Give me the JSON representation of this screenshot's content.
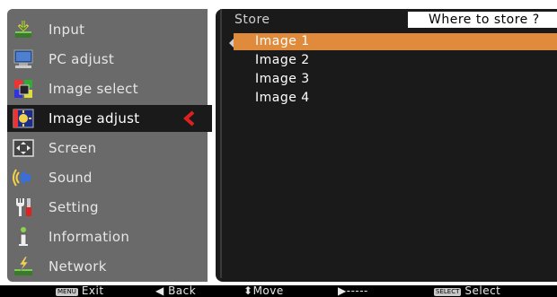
{
  "sidebar": {
    "items": [
      {
        "label": "Input",
        "icon": "input-icon"
      },
      {
        "label": "PC adjust",
        "icon": "pc-adjust-icon"
      },
      {
        "label": "Image select",
        "icon": "image-select-icon"
      },
      {
        "label": "Image adjust",
        "icon": "image-adjust-icon"
      },
      {
        "label": "Screen",
        "icon": "screen-icon"
      },
      {
        "label": "Sound",
        "icon": "sound-icon"
      },
      {
        "label": "Setting",
        "icon": "setting-icon"
      },
      {
        "label": "Information",
        "icon": "information-icon"
      },
      {
        "label": "Network",
        "icon": "network-icon"
      }
    ],
    "selected_index": 3
  },
  "panel": {
    "title": "Store",
    "header": "Where to store ?",
    "options": [
      "Image 1",
      "Image 2",
      "Image 3",
      "Image 4"
    ],
    "active_index": 0
  },
  "footer": {
    "exit_key": "MENU",
    "exit_label": "Exit",
    "back_label": "Back",
    "move_label": "Move",
    "next_label": "-----",
    "select_key": "SELECT",
    "select_label": "Select"
  },
  "colors": {
    "sidebar_bg": "#6a6a6a",
    "panel_bg": "#1a1a1a",
    "highlight": "#e08a3c",
    "selected_arrow": "#e02020"
  }
}
